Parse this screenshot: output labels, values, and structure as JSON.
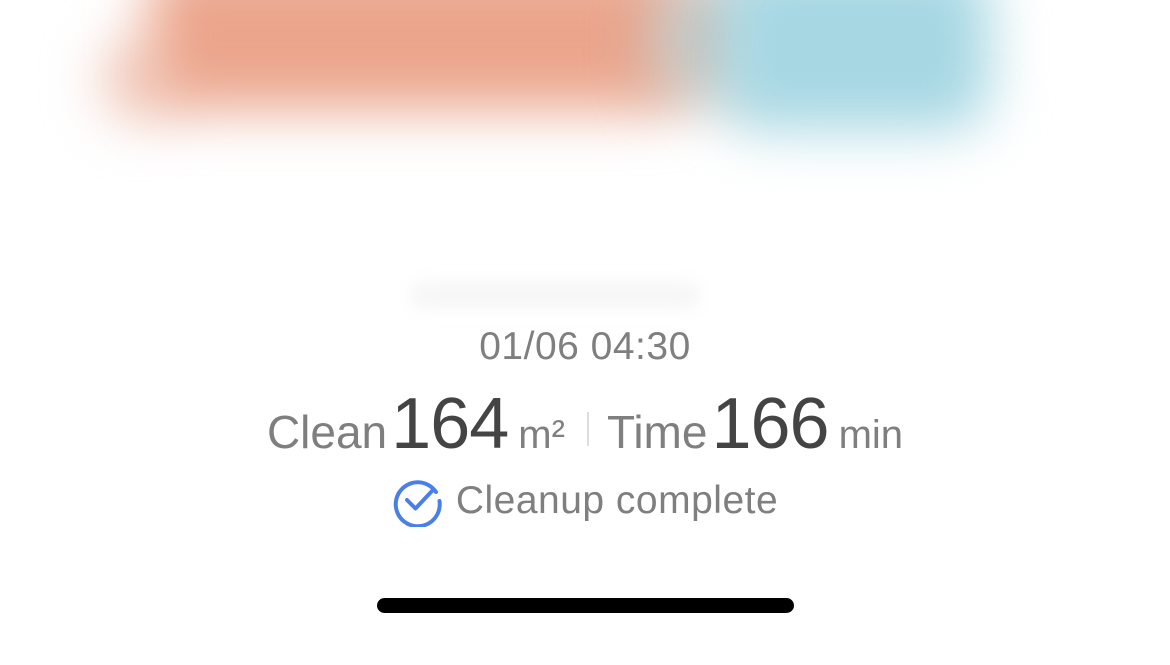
{
  "record": {
    "datetime": "01/06 04:30",
    "clean_label": "Clean",
    "clean_value": "164",
    "clean_unit": "m²",
    "time_label": "Time",
    "time_value": "166",
    "time_unit": "min",
    "status_text": "Cleanup complete",
    "status_icon": "check-circle-icon"
  },
  "colors": {
    "accent": "#4a7fe6",
    "value_text": "#444444",
    "secondary_text": "#7f7f7f",
    "map_orange": "#eba58c",
    "map_blue": "#a6d7e3",
    "home_indicator": "#000000"
  }
}
